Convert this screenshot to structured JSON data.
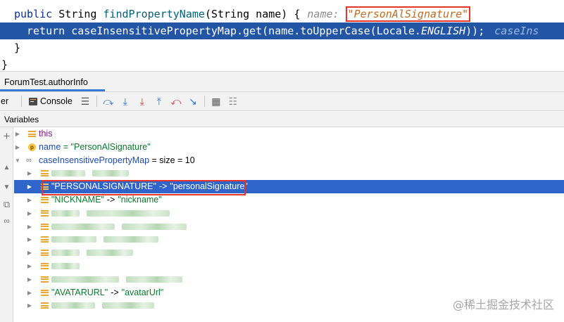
{
  "editor": {
    "line1": {
      "kw": "public ",
      "type": "String ",
      "method": "findPropertyName",
      "params": "(String name) {",
      "hint_label": "name: ",
      "hint_value": "\"PersonAlSignature\""
    },
    "line2": {
      "kw": "return ",
      "map": "caseInsensitivePropertyMap",
      "call": ".get(name.toUpperCase(Locale.",
      "const": "ENGLISH",
      "end": "));",
      "hint": "caseIns"
    },
    "line3": "}",
    "line4": "}"
  },
  "debug": {
    "tab": "ForumTest.authorInfo",
    "toolbar": {
      "cut_label": "er",
      "console_label": "Console"
    },
    "variables_header": "Variables"
  },
  "tree": {
    "this": "this",
    "name_key": "name",
    "name_value": "= \"PersonAlSignature\"",
    "map_key": "caseInsensitivePropertyMap",
    "map_value": "=  size = 10",
    "entries": [
      {
        "key": "",
        "value": ""
      },
      {
        "key": "\"PERSONALSIGNATURE\"",
        "value": "\"personalSignature\"",
        "selected": true
      },
      {
        "key": "\"NICKNAME\"",
        "value": "\"nickname\""
      },
      {
        "key": "",
        "value": ""
      },
      {
        "key": "",
        "value": ""
      },
      {
        "key": "",
        "value": ""
      },
      {
        "key": "",
        "value": ""
      },
      {
        "key": "",
        "value": ""
      },
      {
        "key": "",
        "value": ""
      },
      {
        "key": "\"AVATARURL\"",
        "value": "\"avatarUrl\""
      },
      {
        "key": "",
        "value": ""
      }
    ],
    "arrow_text": "->"
  },
  "icons": [
    "plus-icon",
    "collapse-up-icon",
    "collapse-down-icon",
    "copy-icon",
    "infinity-icon",
    "list-icon",
    "step-over-icon",
    "step-into-icon",
    "force-step-into-icon",
    "step-out-icon",
    "drop-frame-icon",
    "run-to-cursor-icon",
    "table-icon",
    "grid-icon"
  ],
  "colors": {
    "selection": "#2f65ca",
    "code_selection": "#2255a4",
    "highlight_border": "#e8352b",
    "string": "#0b7a2b"
  },
  "watermark": "@稀土掘金技术社区"
}
